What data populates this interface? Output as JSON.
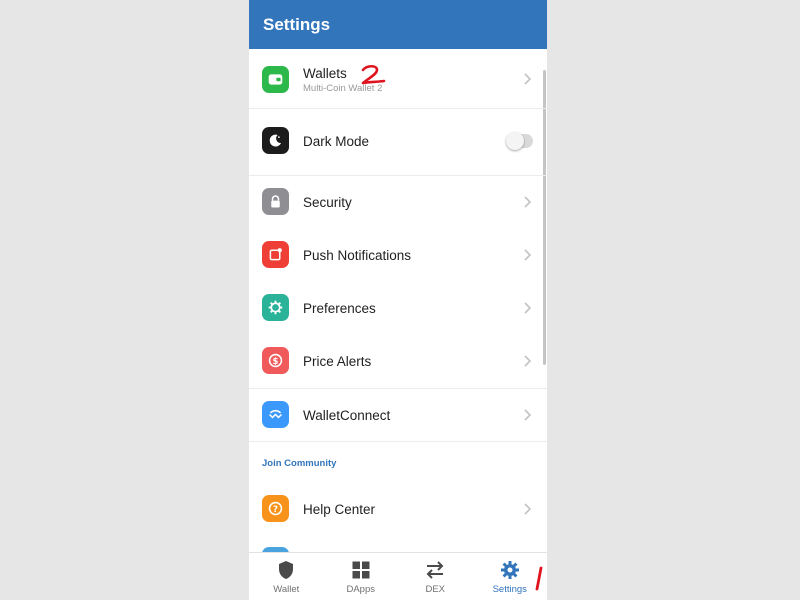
{
  "header": {
    "title": "Settings"
  },
  "settings": [
    {
      "label": "Wallets",
      "sub": "Multi-Coin Wallet 2",
      "icon": "wallet-icon",
      "color": "#2db84b"
    },
    {
      "label": "Dark Mode",
      "icon": "moon-icon",
      "color": "#1c1c1c"
    },
    {
      "label": "Security",
      "icon": "lock-icon",
      "color": "#8e8e93"
    },
    {
      "label": "Push Notifications",
      "icon": "notification-icon",
      "color": "#ef3e36"
    },
    {
      "label": "Preferences",
      "icon": "gear-icon",
      "color": "#2bb39a"
    },
    {
      "label": "Price Alerts",
      "icon": "dollar-icon",
      "color": "#f05a5a"
    },
    {
      "label": "WalletConnect",
      "icon": "walletconnect-icon",
      "color": "#3b99fc"
    }
  ],
  "community": {
    "title": "Join Community",
    "items": [
      {
        "label": "Help Center",
        "icon": "help-icon",
        "color": "#f7931a"
      }
    ]
  },
  "dark_mode_enabled": false,
  "tabs": [
    {
      "label": "Wallet",
      "icon": "shield-icon",
      "active": false
    },
    {
      "label": "DApps",
      "icon": "grid-icon",
      "active": false
    },
    {
      "label": "DEX",
      "icon": "swap-icon",
      "active": false
    },
    {
      "label": "Settings",
      "icon": "gear-icon",
      "active": true
    }
  ],
  "annotations": [
    "2",
    "1"
  ],
  "colors": {
    "brand": "#3375bb",
    "annotation": "#e0141e"
  }
}
